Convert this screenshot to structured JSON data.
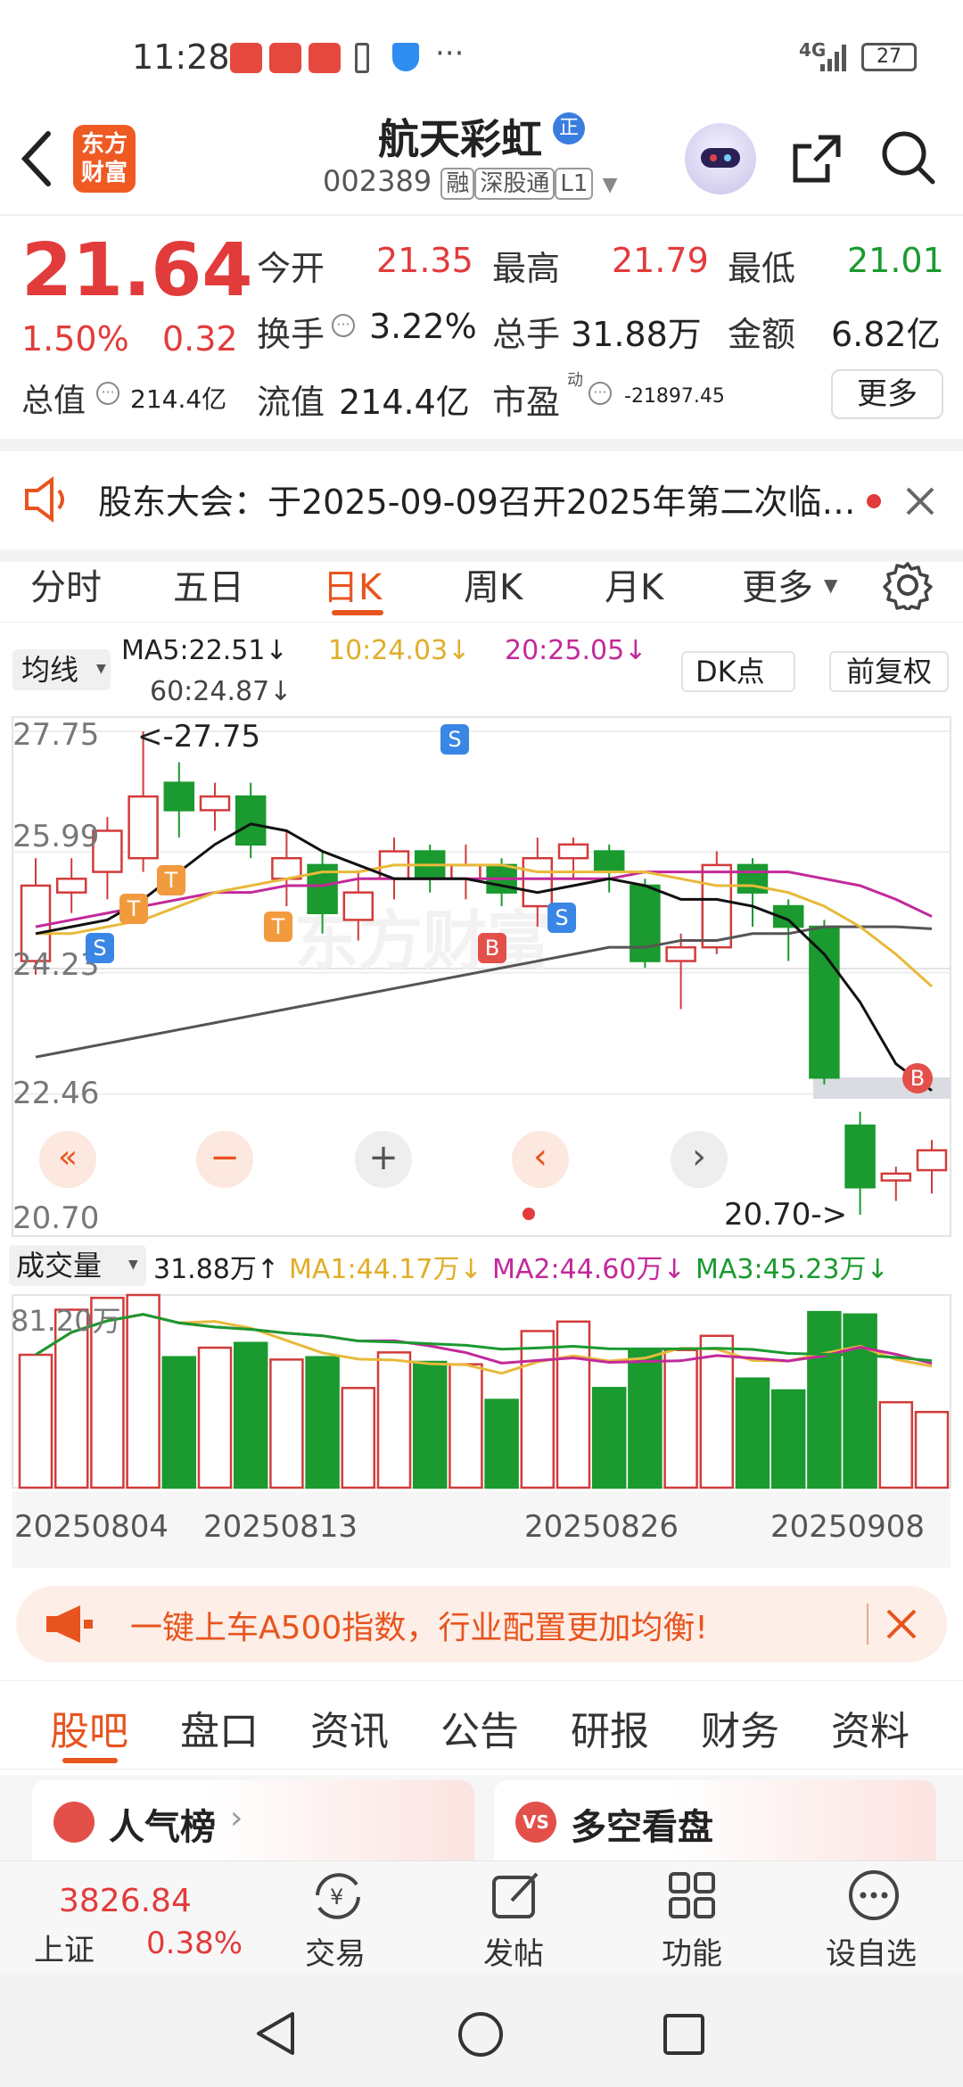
{
  "status": {
    "time": "11:28",
    "signal": "4G",
    "battery": "27"
  },
  "header": {
    "logo_line1": "东方",
    "logo_line2": "财富",
    "stock_name": "航天彩虹",
    "stock_badge": "正",
    "stock_code": "002389",
    "tag1": "融",
    "tag2": "深股通",
    "tag3": "L1"
  },
  "quote": {
    "price": "21.64",
    "pct": "1.50%",
    "chg": "0.32",
    "open_label": "今开",
    "open": "21.35",
    "high_label": "最高",
    "high": "21.79",
    "low_label": "最低",
    "low": "21.01",
    "turnover_label": "换手",
    "turnover": "3.22%",
    "volume_label": "总手",
    "volume": "31.88万",
    "amount_label": "金额",
    "amount": "6.82亿",
    "mktcap_label": "总值",
    "mktcap": "214.4亿",
    "float_label": "流值",
    "float": "214.4亿",
    "pe_label": "市盈",
    "pe_sup": "动",
    "pe": "-21897.45",
    "more": "更多"
  },
  "notice": {
    "text": "股东大会：于2025-09-09召开2025年第二次临…"
  },
  "chart_tabs": [
    "分时",
    "五日",
    "日K",
    "周K",
    "月K",
    "更多"
  ],
  "chart_tab_active": 2,
  "ma_row": {
    "selector": "均线",
    "ma5": "MA5:22.51↓",
    "ma10": "10:24.03↓",
    "ma20": "20:25.05↓",
    "ma60": "60:24.87↓",
    "dk": "DK点",
    "adjust": "前复权"
  },
  "kline": {
    "y_labels": [
      "27.75",
      "25.99",
      "24.23",
      "22.46",
      "20.70"
    ],
    "max_note": "<-27.75",
    "min_note": "20.70->",
    "markers": [
      "S",
      "T",
      "T",
      "T",
      "S",
      "B",
      "S",
      "B"
    ]
  },
  "vol_row": {
    "selector": "成交量",
    "vol": "31.88万↑",
    "ma1": "MA1:44.17万↓",
    "ma2": "MA2:44.60万↓",
    "ma3": "MA3:45.23万↓",
    "vmax": "81.20万"
  },
  "dates": [
    "20250804",
    "20250813",
    "20250826",
    "20250908"
  ],
  "chart_data": {
    "type": "candlestick",
    "candles": [
      {
        "o": 24.4,
        "c": 25.5,
        "h": 25.9,
        "l": 24.2,
        "color": "up"
      },
      {
        "o": 25.4,
        "c": 25.6,
        "h": 25.9,
        "l": 25.1,
        "color": "up"
      },
      {
        "o": 25.7,
        "c": 26.3,
        "h": 26.5,
        "l": 25.3,
        "color": "up"
      },
      {
        "o": 25.9,
        "c": 26.8,
        "h": 27.75,
        "l": 25.7,
        "color": "up"
      },
      {
        "o": 27.0,
        "c": 26.6,
        "h": 27.3,
        "l": 26.2,
        "color": "down"
      },
      {
        "o": 26.6,
        "c": 26.8,
        "h": 27.0,
        "l": 26.3,
        "color": "up"
      },
      {
        "o": 26.8,
        "c": 26.1,
        "h": 27.0,
        "l": 25.9,
        "color": "down"
      },
      {
        "o": 25.6,
        "c": 25.9,
        "h": 26.3,
        "l": 25.2,
        "color": "up"
      },
      {
        "o": 25.8,
        "c": 25.1,
        "h": 26.0,
        "l": 24.8,
        "color": "down"
      },
      {
        "o": 25.0,
        "c": 25.4,
        "h": 25.7,
        "l": 24.7,
        "color": "up"
      },
      {
        "o": 25.6,
        "c": 26.0,
        "h": 26.2,
        "l": 25.3,
        "color": "up"
      },
      {
        "o": 26.0,
        "c": 25.6,
        "h": 26.1,
        "l": 25.4,
        "color": "down"
      },
      {
        "o": 25.6,
        "c": 25.8,
        "h": 26.1,
        "l": 25.3,
        "color": "up"
      },
      {
        "o": 25.8,
        "c": 25.4,
        "h": 25.9,
        "l": 25.2,
        "color": "down"
      },
      {
        "o": 25.2,
        "c": 25.9,
        "h": 26.2,
        "l": 24.9,
        "color": "up"
      },
      {
        "o": 25.9,
        "c": 26.1,
        "h": 26.2,
        "l": 25.6,
        "color": "up"
      },
      {
        "o": 26.0,
        "c": 25.7,
        "h": 26.1,
        "l": 25.4,
        "color": "down"
      },
      {
        "o": 25.5,
        "c": 24.4,
        "h": 25.6,
        "l": 24.3,
        "color": "down"
      },
      {
        "o": 24.4,
        "c": 24.6,
        "h": 24.8,
        "l": 23.7,
        "color": "up"
      },
      {
        "o": 24.6,
        "c": 25.8,
        "h": 26.0,
        "l": 24.5,
        "color": "up"
      },
      {
        "o": 25.8,
        "c": 25.4,
        "h": 25.9,
        "l": 24.9,
        "color": "down"
      },
      {
        "o": 25.2,
        "c": 24.9,
        "h": 25.3,
        "l": 24.4,
        "color": "down"
      },
      {
        "o": 24.9,
        "c": 22.7,
        "h": 25.0,
        "l": 22.6,
        "color": "down"
      },
      {
        "o": 22.0,
        "c": 21.1,
        "h": 22.2,
        "l": 20.7,
        "color": "down"
      },
      {
        "o": 21.2,
        "c": 21.3,
        "h": 21.4,
        "l": 20.9,
        "color": "up"
      },
      {
        "o": 21.35,
        "c": 21.64,
        "h": 21.79,
        "l": 21.01,
        "color": "up"
      }
    ],
    "ma5": [
      24.8,
      24.9,
      25.0,
      25.3,
      25.7,
      26.1,
      26.4,
      26.3,
      26.0,
      25.8,
      25.6,
      25.6,
      25.6,
      25.5,
      25.4,
      25.5,
      25.6,
      25.5,
      25.3,
      25.3,
      25.2,
      25.0,
      24.5,
      23.8,
      22.9,
      22.51
    ],
    "ma10": [
      24.8,
      24.8,
      24.9,
      25.0,
      25.2,
      25.4,
      25.5,
      25.6,
      25.7,
      25.7,
      25.8,
      25.8,
      25.8,
      25.8,
      25.7,
      25.7,
      25.7,
      25.7,
      25.6,
      25.5,
      25.5,
      25.4,
      25.2,
      24.9,
      24.5,
      24.03
    ],
    "ma20": [
      24.9,
      25.0,
      25.1,
      25.2,
      25.3,
      25.4,
      25.4,
      25.5,
      25.5,
      25.6,
      25.6,
      25.6,
      25.6,
      25.6,
      25.6,
      25.6,
      25.6,
      25.7,
      25.7,
      25.7,
      25.7,
      25.7,
      25.6,
      25.5,
      25.3,
      25.05
    ],
    "ma60": [
      23.0,
      23.1,
      23.2,
      23.3,
      23.4,
      23.5,
      23.6,
      23.7,
      23.8,
      23.9,
      24.0,
      24.1,
      24.2,
      24.3,
      24.4,
      24.5,
      24.6,
      24.6,
      24.7,
      24.7,
      24.8,
      24.8,
      24.9,
      24.9,
      24.9,
      24.87
    ],
    "volume_wan": [
      56,
      75,
      80,
      81.2,
      55,
      59,
      61,
      54,
      55,
      42,
      57,
      53,
      52,
      37,
      66,
      70,
      42,
      58,
      58,
      64,
      46,
      41,
      74,
      73,
      36,
      31.88
    ]
  },
  "promo": {
    "text": "一键上车A500指数，行业配置更加均衡!"
  },
  "feature_tabs": [
    "股吧",
    "盘口",
    "资讯",
    "公告",
    "研报",
    "财务",
    "资料"
  ],
  "cards": {
    "left": "人气榜",
    "right": "多空看盘"
  },
  "bottom_nav": {
    "index_value": "3826.84",
    "index_name": "上证",
    "index_pct": "0.38%",
    "trade": "交易",
    "post": "发帖",
    "func": "功能",
    "watch": "设自选"
  },
  "colors": {
    "up": "#d23b3b",
    "down": "#1a9a2f",
    "ma5": "#111111",
    "ma10": "#e8b93a",
    "ma20": "#c2299a",
    "ma60": "#555555",
    "accent": "#e8541e"
  }
}
